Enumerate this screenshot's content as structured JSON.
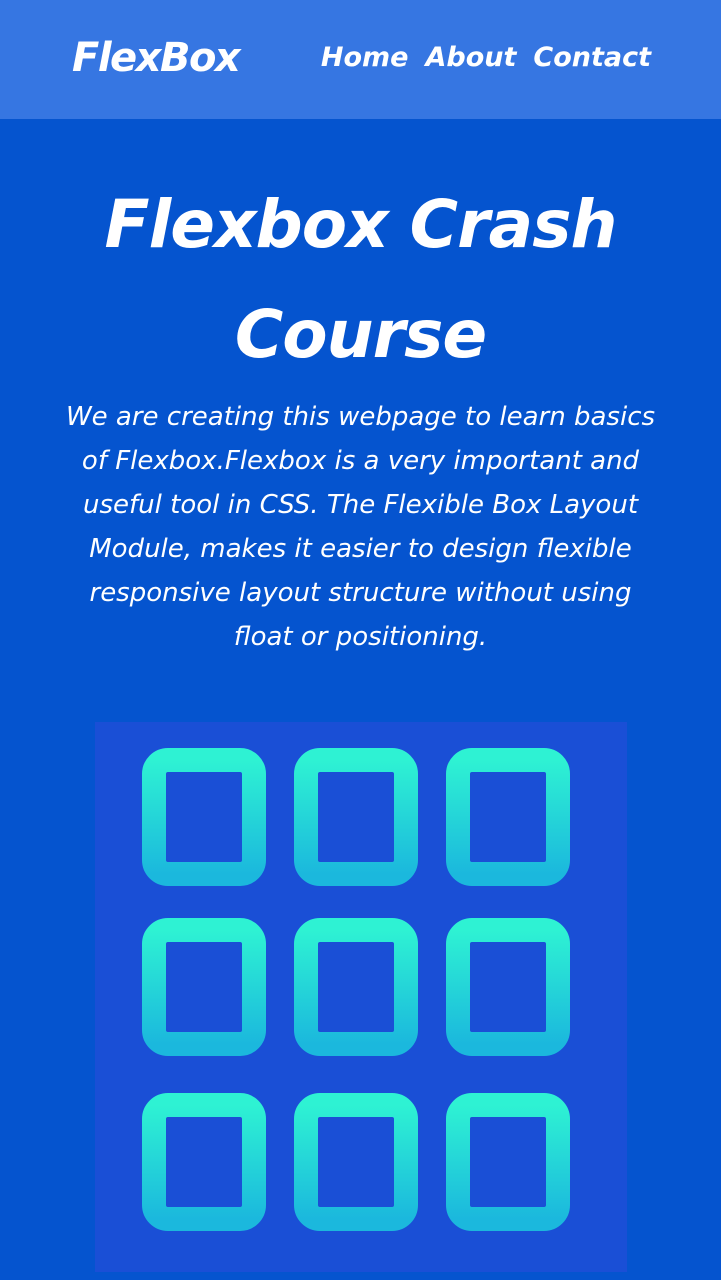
{
  "header": {
    "logo": "FlexBox",
    "nav": [
      {
        "label": "Home"
      },
      {
        "label": "About"
      },
      {
        "label": "Contact"
      }
    ]
  },
  "hero": {
    "title_line1": "Flexbox Crash",
    "title_line2": "Course",
    "description": "We are creating this webpage to learn basics of Flexbox.Flexbox is a very important and useful tool in CSS. The Flexible Box Layout Module, makes it easier to design flexible responsive layout structure without using float or positioning."
  },
  "image": {
    "icon": "flexbox-grid-icon",
    "grid_rows": 3,
    "grid_cols": 3
  },
  "colors": {
    "page_background": "#0554cf",
    "navbar_background": "#3676e2",
    "image_background": "#1a4fd6",
    "box_gradient_top": "#2ef2d3",
    "box_gradient_bottom": "#1bb8dd",
    "text": "#ffffff"
  }
}
